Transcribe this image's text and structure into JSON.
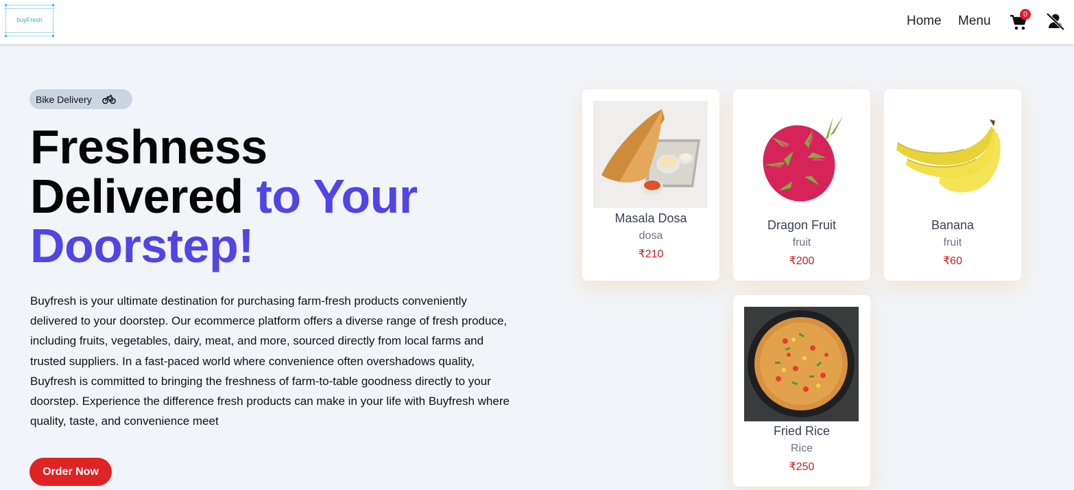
{
  "header": {
    "logo_text": "buyFresh",
    "nav": [
      {
        "label": "Home"
      },
      {
        "label": "Menu"
      }
    ],
    "cart_count": "0",
    "icons": {
      "cart": "cart-icon",
      "user": "user-slash-icon"
    }
  },
  "hero": {
    "pill_label": "Bike Delivery",
    "headline_plain": "Freshness Delivered",
    "headline_line1": "Freshness",
    "headline_line2_plain": "Delivered",
    "headline_line2_accent": "to Your",
    "headline_line3_accent": "Doorstep!",
    "description": "Buyfresh is your ultimate destination for purchasing farm-fresh products conveniently delivered to your doorstep. Our ecommerce platform offers a diverse range of fresh produce, including fruits, vegetables, dairy, meat, and more, sourced directly from local farms and trusted suppliers. In a fast-paced world where convenience often overshadows quality, Buyfresh is committed to bringing the freshness of farm-to-table goodness directly to your doorstep. Experience the difference fresh products can make in your life with Buyfresh where quality, taste, and convenience meet",
    "cta_label": "Order Now"
  },
  "products": [
    {
      "name": "Masala Dosa",
      "category": "dosa",
      "price": "₹210"
    },
    {
      "name": "Dragon Fruit",
      "category": "fruit",
      "price": "₹200"
    },
    {
      "name": "Banana",
      "category": "fruit",
      "price": "₹60"
    },
    {
      "name": "Fried Rice",
      "category": "Rice",
      "price": "₹250"
    }
  ],
  "colors": {
    "accent": "#5045e5",
    "cta": "#e02424",
    "price": "#c81e1e"
  }
}
